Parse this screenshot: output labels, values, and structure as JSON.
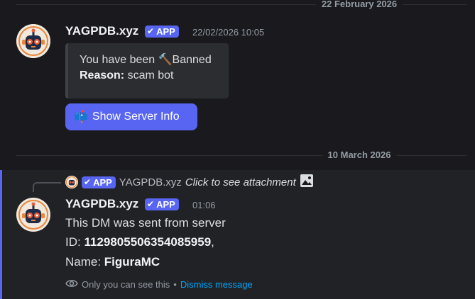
{
  "dividers": [
    {
      "label": "22 February 2026"
    },
    {
      "label": "10 March 2026"
    }
  ],
  "message1": {
    "username": "YAGPDB.xyz",
    "badge": "APP",
    "timestamp": "22/02/2026 10:05",
    "embed": {
      "line1_prefix": "You have been ",
      "line1_icon": "hammer-icon",
      "line1_suffix": "Banned",
      "reason_label": "Reason:",
      "reason_value": " scam bot"
    },
    "button": {
      "icon": "mailbox-icon",
      "label": "Show Server Info"
    }
  },
  "message2": {
    "reply": {
      "badge": "APP",
      "username": "YAGPDB.xyz",
      "text": "Click to see attachment",
      "icon": "image-icon"
    },
    "username": "YAGPDB.xyz",
    "badge": "APP",
    "timestamp": "01:06",
    "lines": {
      "line1": "This DM was sent from server",
      "id_label": "ID: ",
      "id_value": "1129805506354085959",
      "id_suffix": ",",
      "name_label": "Name: ",
      "name_value": "FiguraMC"
    },
    "ephemeral": {
      "icon": "eye-icon",
      "text": "Only you can see this",
      "separator": "•",
      "dismiss": "Dismiss message"
    }
  },
  "colors": {
    "background": "#1a1a1e",
    "accent": "#5865f2",
    "link": "#00a8fc"
  }
}
